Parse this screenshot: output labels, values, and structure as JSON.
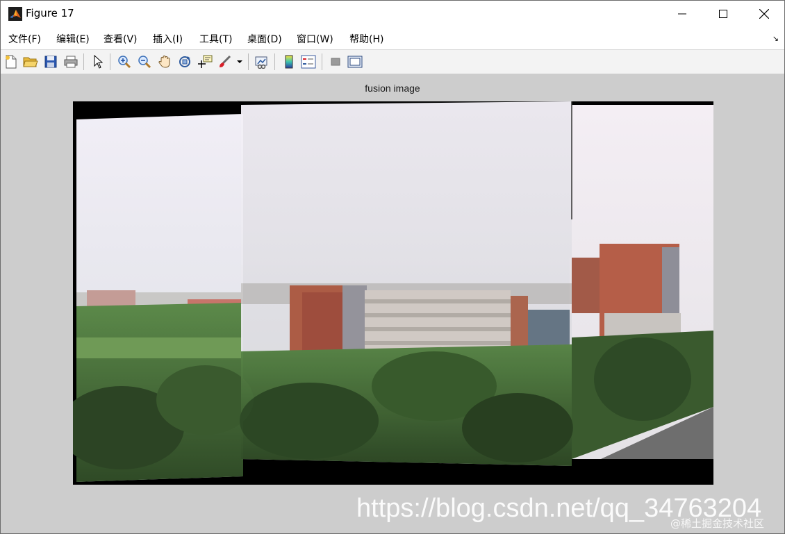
{
  "window": {
    "title": "Figure 17",
    "icons": {
      "app": "matlab-logo-icon",
      "minimize": "minimize-icon",
      "maximize": "maximize-icon",
      "close": "close-icon"
    }
  },
  "menubar": {
    "items": [
      {
        "label": "文件(F)"
      },
      {
        "label": "编辑(E)"
      },
      {
        "label": "查看(V)"
      },
      {
        "label": "插入(I)"
      },
      {
        "label": "工具(T)"
      },
      {
        "label": "桌面(D)"
      },
      {
        "label": "窗口(W)"
      },
      {
        "label": "帮助(H)"
      }
    ],
    "dock_arrow": "↘"
  },
  "toolbar": {
    "buttons": [
      {
        "icon": "new-figure-icon"
      },
      {
        "icon": "open-folder-icon"
      },
      {
        "icon": "save-icon"
      },
      {
        "icon": "print-icon"
      },
      {
        "icon": "select-arrow-icon"
      },
      {
        "icon": "zoom-in-icon"
      },
      {
        "icon": "zoom-out-icon"
      },
      {
        "icon": "pan-hand-icon"
      },
      {
        "icon": "rotate-3d-icon"
      },
      {
        "icon": "data-cursor-icon"
      },
      {
        "icon": "brush-icon"
      },
      {
        "icon": "link-plot-icon"
      },
      {
        "icon": "colorbar-icon"
      },
      {
        "icon": "legend-icon"
      },
      {
        "icon": "hide-plot-tools-icon"
      },
      {
        "icon": "show-plot-tools-icon"
      }
    ]
  },
  "figure": {
    "axes_title": "fusion image",
    "image_description": "stitched panorama of campus buildings"
  },
  "watermark": {
    "url": "https://blog.csdn.net/qq_34763204",
    "site": "@稀土掘金技术社区"
  }
}
